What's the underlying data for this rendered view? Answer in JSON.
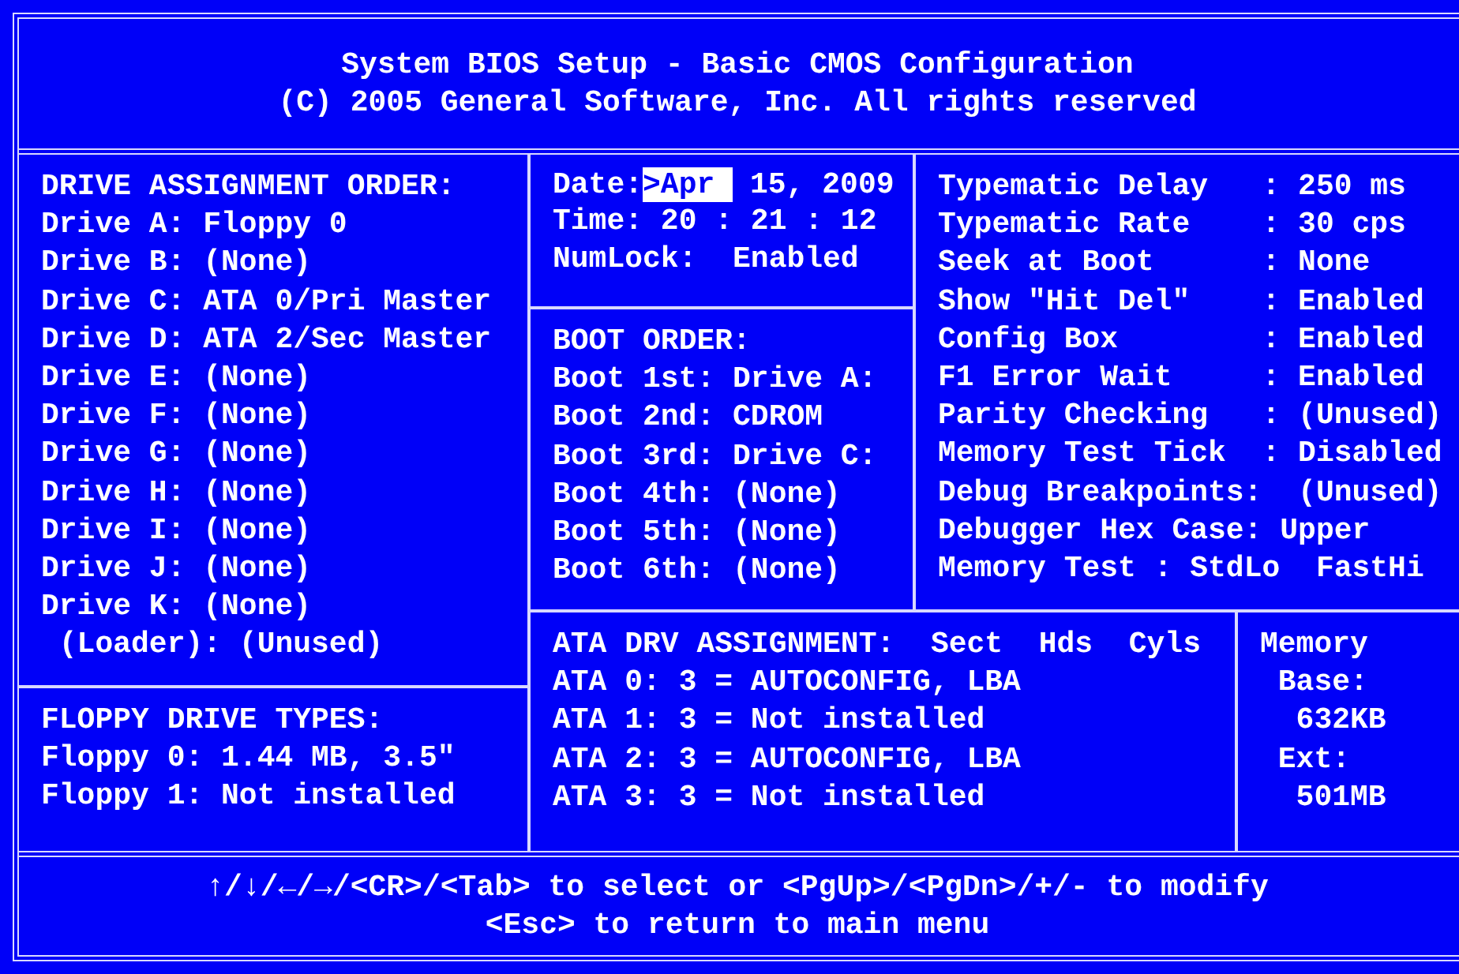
{
  "header": {
    "title": "System BIOS Setup - Basic CMOS Configuration",
    "copyright": "(C) 2005 General Software, Inc. All rights reserved"
  },
  "drive_assignment": {
    "heading": "DRIVE ASSIGNMENT ORDER:",
    "lines": [
      "Drive A: Floppy 0",
      "Drive B: (None)",
      "Drive C: ATA 0/Pri Master",
      "Drive D: ATA 2/Sec Master",
      "Drive E: (None)",
      "Drive F: (None)",
      "Drive G: (None)",
      "Drive H: (None)",
      "Drive I: (None)",
      "Drive J: (None)",
      "Drive K: (None)",
      " (Loader): (Unused)"
    ]
  },
  "floppy_types": {
    "heading": "FLOPPY DRIVE TYPES:",
    "lines": [
      "Floppy 0: 1.44 MB, 3.5\"",
      "Floppy 1: Not installed"
    ]
  },
  "date_time": {
    "date_label": "Date:",
    "month": {
      "text": ">Apr",
      "selected": true
    },
    "date_rest": " 15, 2009",
    "time": "Time: 20 : 21 : 12",
    "numlock": "NumLock:  Enabled"
  },
  "boot_order": {
    "heading": "BOOT ORDER:",
    "lines": [
      "Boot 1st: Drive A:",
      "Boot 2nd: CDROM",
      "Boot 3rd: Drive C:",
      "Boot 4th: (None)",
      "Boot 5th: (None)",
      "Boot 6th: (None)"
    ]
  },
  "settings": [
    "Typematic Delay   : 250 ms",
    "Typematic Rate    : 30 cps",
    "Seek at Boot      : None",
    "Show \"Hit Del\"    : Enabled",
    "Config Box        : Enabled",
    "F1 Error Wait     : Enabled",
    "Parity Checking   : (Unused)",
    "Memory Test Tick  : Disabled",
    "Debug Breakpoints:  (Unused)",
    "Debugger Hex Case: Upper",
    "Memory Test : StdLo  FastHi"
  ],
  "ata_assignment": {
    "heading": "ATA DRV ASSIGNMENT:  Sect  Hds  Cyls",
    "lines": [
      "ATA 0: 3 = AUTOCONFIG, LBA",
      "ATA 1: 3 = Not installed",
      "ATA 2: 3 = AUTOCONFIG, LBA",
      "ATA 3: 3 = Not installed"
    ]
  },
  "memory": [
    {
      "kind": "title",
      "text": "Memory"
    },
    {
      "kind": "label",
      "text": "Base:"
    },
    {
      "kind": "value",
      "text": "632KB"
    },
    {
      "kind": "label",
      "text": "Ext:"
    },
    {
      "kind": "value",
      "text": "501MB"
    }
  ],
  "footer": [
    "↑/↓/←/→/<CR>/<Tab> to select or <PgUp>/<PgDn>/+/- to modify",
    "<Esc> to return to main menu"
  ]
}
